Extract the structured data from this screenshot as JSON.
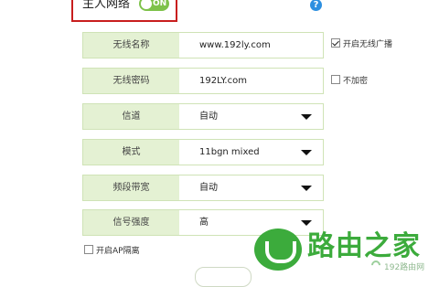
{
  "header": {
    "title": "主人网络",
    "toggle_label": "ON",
    "help_symbol": "?"
  },
  "fields": [
    {
      "label": "无线名称",
      "value": "www.192ly.com",
      "type": "text"
    },
    {
      "label": "无线密码",
      "value": "192LY.com",
      "type": "text"
    },
    {
      "label": "信道",
      "value": "自动",
      "type": "select"
    },
    {
      "label": "模式",
      "value": "11bgn mixed",
      "type": "select"
    },
    {
      "label": "频段带宽",
      "value": "自动",
      "type": "select"
    },
    {
      "label": "信号强度",
      "value": "高",
      "type": "select"
    }
  ],
  "options": {
    "broadcast_label": "开启无线广播",
    "broadcast_checked": true,
    "no_encrypt_label": "不加密",
    "no_encrypt_checked": false,
    "ap_isolation_label": "开启AP隔离",
    "ap_isolation_checked": false
  },
  "watermark": {
    "brand": "路由之家",
    "sub": "192路由网"
  },
  "colors": {
    "accent_green": "#7ec24a",
    "label_bg": "#e4f1d3",
    "highlight_border": "#c81e1e",
    "help_blue": "#2d8fe0",
    "watermark_green": "#3cab3c"
  }
}
